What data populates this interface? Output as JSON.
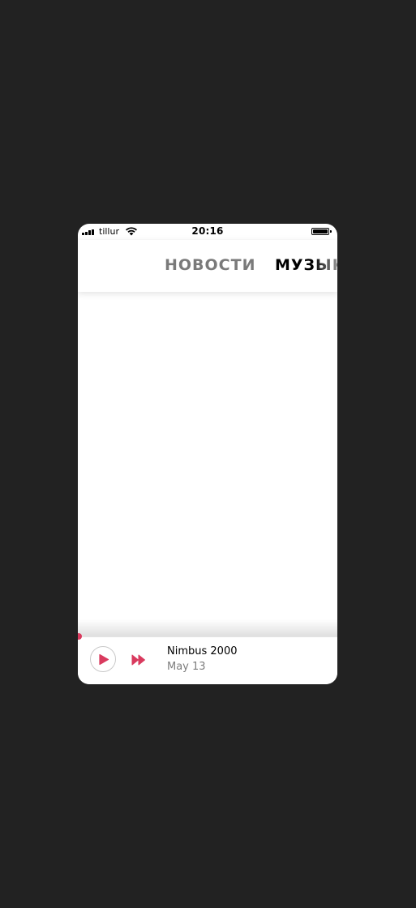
{
  "status_bar": {
    "carrier": "tillur",
    "time": "20:16"
  },
  "tabs": [
    {
      "label": "НОВОСТИ",
      "active": false
    },
    {
      "label": "МУЗЫКА",
      "active": true
    }
  ],
  "player": {
    "title": "Nimbus 2000",
    "subtitle": "May 13",
    "progress": 0,
    "accent_color": "#d93a5e",
    "play_icon": "play-icon",
    "forward_icon": "fast-forward-icon"
  }
}
